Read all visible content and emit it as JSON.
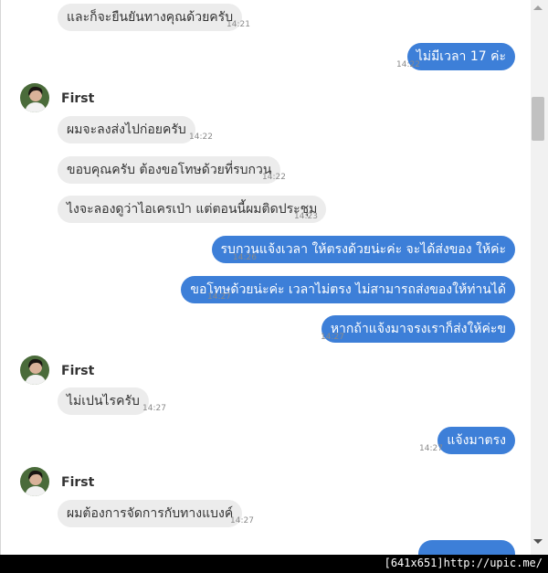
{
  "contact": {
    "name": "First"
  },
  "messages": [
    {
      "text": "และก็จะยืนยันทางคุณด้วยครับ",
      "time": "14:21"
    },
    {
      "text": "ไม่มีเวลา 17 ค่ะ",
      "time": "14:22"
    },
    {
      "text": "ผมจะลงส่งไปก่อยครับ",
      "time": "14:22"
    },
    {
      "text": "ขอบคุณครับ ต้องขอโทษด้วยที่รบกวน",
      "time": "14:22"
    },
    {
      "text": "ไงจะลองดูว่าไอเครเป่า แต่ตอนนี้ผมติดประชุม",
      "time": "14:23"
    },
    {
      "text": "รบกวนแจ้งเวลา ให้ตรงด้วยน่ะค่ะ จะได้ส่งของ ให้ค่ะ",
      "time": "14:26"
    },
    {
      "text": "ขอโทษด้วยน่ะค่ะ เวลาไม่ตรง ไม่สามารถส่งของให้ท่านได้",
      "time": "14:27"
    },
    {
      "text": "หากถ้าแจ้งมาจรงเราก็ส่งให้ค่ะข",
      "time": "14:27"
    },
    {
      "text": "ไม่เปนไรครับ",
      "time": "14:27"
    },
    {
      "text": "แจ้งมาตรง",
      "time": "14:27"
    },
    {
      "text": "ผมต้องการจัดการกับทางแบงค์",
      "time": "14:27"
    }
  ],
  "footer": {
    "text": "[641x651]http://upic.me/"
  }
}
